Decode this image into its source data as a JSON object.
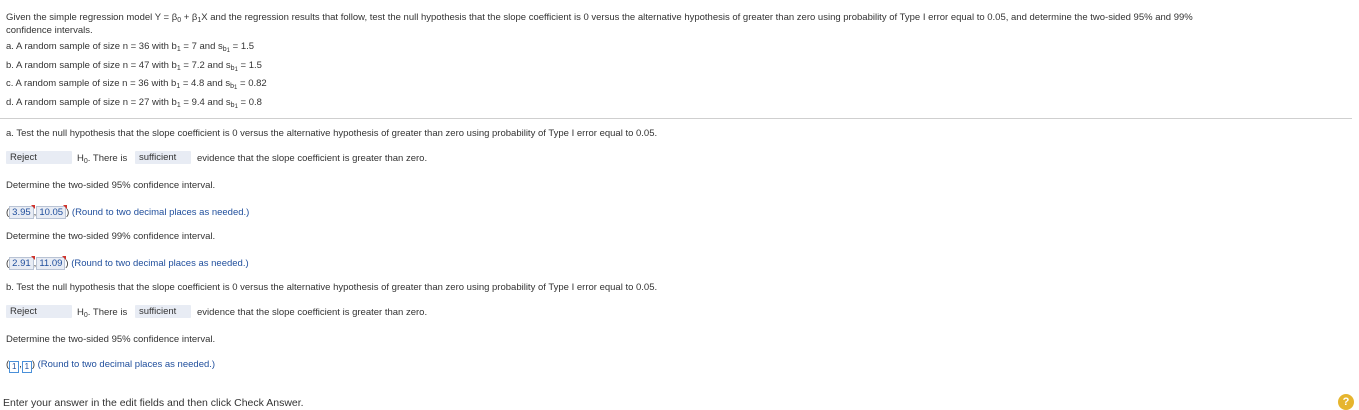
{
  "problem": {
    "intro_1": "Given the simple regression model Y = β",
    "intro_2": " + β",
    "intro_3": "X and the regression results that follow, test the null hypothesis that the slope coefficient is 0 versus the alternative hypothesis of greater than zero using probability of Type I error equal to 0.05, and determine the two-sided 95% and 99%",
    "intro_4": "confidence intervals.",
    "items": [
      {
        "pre": "a. A random sample of size n = 36 with b",
        "mid": " = 7 and s",
        "post": " = 1.5"
      },
      {
        "pre": "b. A random sample of size n = 47 with b",
        "mid": " = 7.2 and s",
        "post": " = 1.5"
      },
      {
        "pre": "c. A random sample of size n = 36 with b",
        "mid": " = 4.8 and s",
        "post": " = 0.82"
      },
      {
        "pre": "d. A random sample of size n = 27 with b",
        "mid": " = 9.4 and s",
        "post": " = 0.8"
      }
    ]
  },
  "part_a": {
    "question": "a. Test the null hypothesis that the slope coefficient is 0 versus the alternative hypothesis of greater than zero using probability of Type I error equal to 0.05.",
    "decision": "Reject",
    "h0_text": "H",
    "h0_rest": ". There is",
    "evidence": "sufficient",
    "conclusion": "evidence that the slope coefficient is greater than zero.",
    "ci95_prompt": "Determine the two-sided 95% confidence interval.",
    "ci95_low": "3.95",
    "ci95_high": "10.05",
    "ci99_prompt": "Determine the two-sided 99% confidence interval.",
    "ci99_low": "2.91",
    "ci99_high": "11.09",
    "round_note": "(Round to two decimal places as needed.)"
  },
  "part_b": {
    "question": "b. Test the null hypothesis that the slope coefficient is 0 versus the alternative hypothesis of greater than zero using probability of Type I error equal to 0.05.",
    "decision": "Reject",
    "h0_text": "H",
    "h0_rest": ". There is",
    "evidence": "sufficient",
    "conclusion": "evidence that the slope coefficient is greater than zero.",
    "ci95_prompt": "Determine the two-sided 95% confidence interval.",
    "ci95_low": "1",
    "ci95_high": "1",
    "round_note": "(Round to two decimal places as needed.)"
  },
  "footer": {
    "instruction": "Enter your answer in the edit fields and then click Check Answer.",
    "help": "?"
  },
  "subscripts": {
    "zero": "0",
    "one": "1",
    "b": "b",
    "one_small": "1"
  }
}
